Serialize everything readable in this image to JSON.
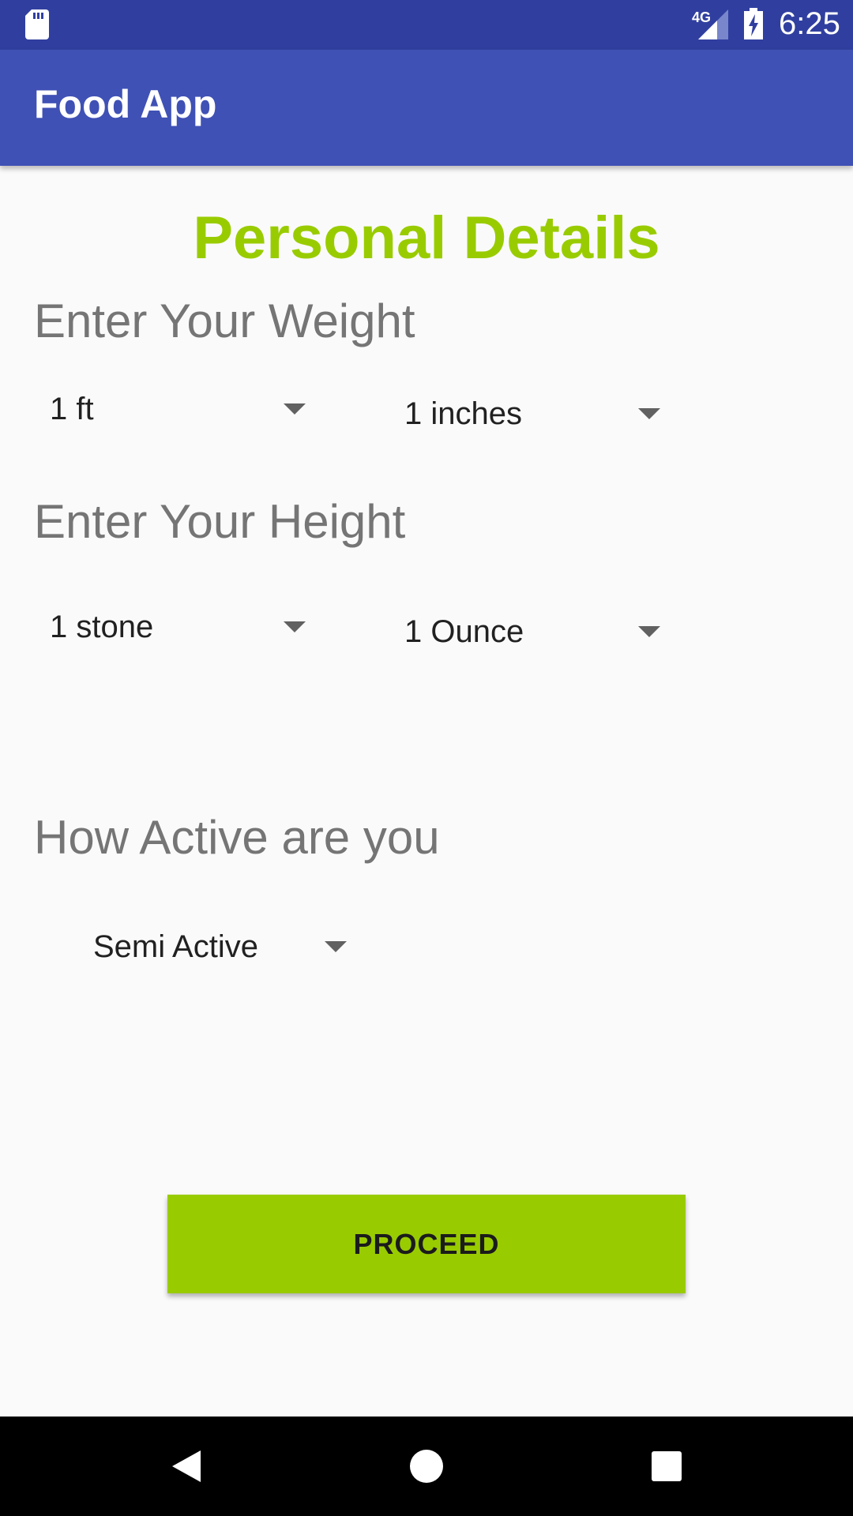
{
  "status_bar": {
    "network": "4G",
    "time": "6:25",
    "icons": [
      "sd-card-icon",
      "signal-icon",
      "battery-charging-icon"
    ]
  },
  "app_bar": {
    "title": "Food App"
  },
  "form": {
    "heading": "Personal Details",
    "weight": {
      "label": "Enter Your Weight",
      "unit1_value": "1 ft",
      "unit2_value": "1 inches"
    },
    "height": {
      "label": "Enter Your Height",
      "unit1_value": "1 stone",
      "unit2_value": "1 Ounce"
    },
    "activity": {
      "label": "How Active are you",
      "value": "Semi Active"
    },
    "proceed_label": "PROCEED"
  },
  "colors": {
    "status_bar": "#303f9f",
    "app_bar": "#3f51b5",
    "accent_green": "#99cc00",
    "label_gray": "#757575"
  },
  "nav_bar": {
    "icons": [
      "back-icon",
      "home-icon",
      "recents-icon"
    ]
  }
}
